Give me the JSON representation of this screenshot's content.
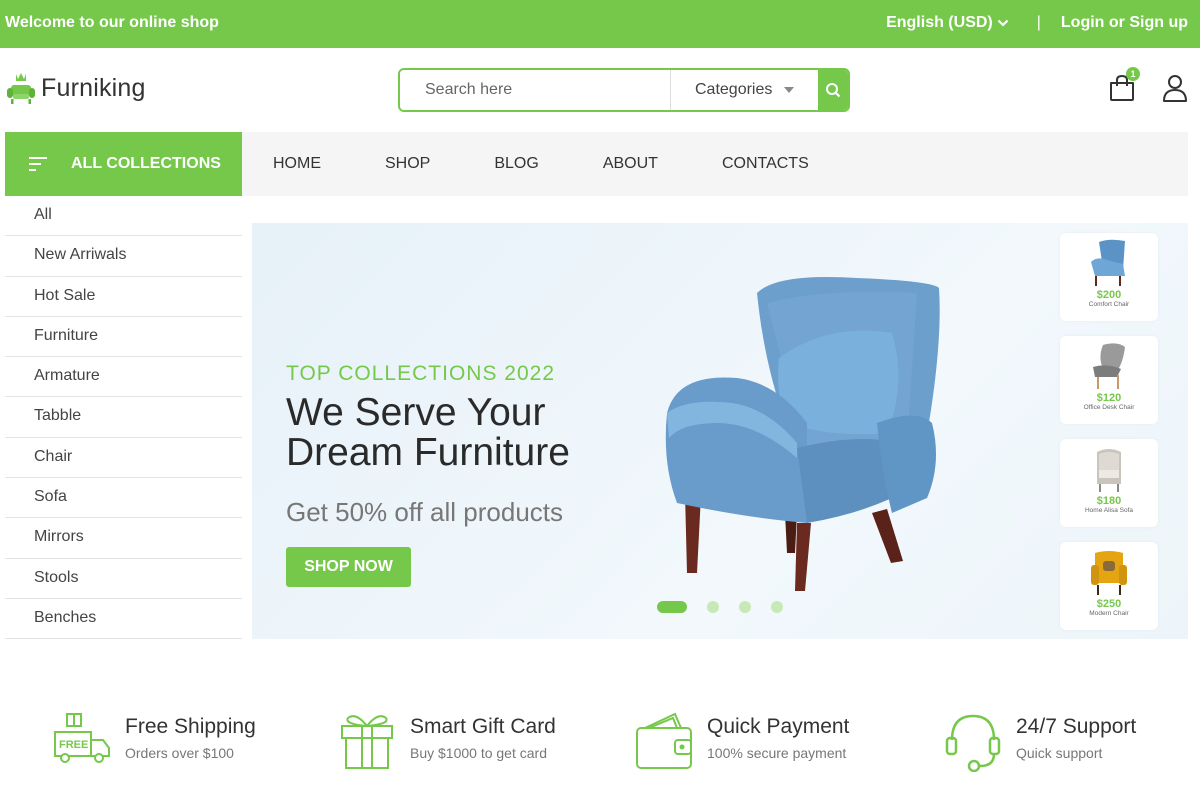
{
  "topbar": {
    "welcome": "Welcome to our online shop",
    "language": "English (USD)",
    "separator": "|",
    "login": "Login or Sign up"
  },
  "header": {
    "brand": "Furniking",
    "search_placeholder": "Search here",
    "categories_label": "Categories",
    "cart_count": "1"
  },
  "sidebar": {
    "header": "ALL COLLECTIONS",
    "items": [
      {
        "label": "All"
      },
      {
        "label": "New Arriwals"
      },
      {
        "label": "Hot Sale"
      },
      {
        "label": "Furniture"
      },
      {
        "label": "Armature"
      },
      {
        "label": "Tabble"
      },
      {
        "label": "Chair"
      },
      {
        "label": "Sofa"
      },
      {
        "label": "Mirrors"
      },
      {
        "label": "Stools"
      },
      {
        "label": "Benches"
      }
    ]
  },
  "nav": {
    "items": [
      {
        "label": "HOME"
      },
      {
        "label": "SHOP"
      },
      {
        "label": "BLOG"
      },
      {
        "label": "ABOUT"
      },
      {
        "label": "CONTACTS"
      }
    ]
  },
  "hero": {
    "eyebrow": "TOP COLLECTIONS 2022",
    "title": "We Serve Your Dream Furniture",
    "subtitle": "Get 50% off all products",
    "cta": "SHOP NOW",
    "slides_count": 4,
    "active_slide": 1,
    "thumbs": [
      {
        "price": "$200",
        "name": "Comfort Chair"
      },
      {
        "price": "$120",
        "name": "Office Desk Chair"
      },
      {
        "price": "$180",
        "name": "Home Alisa Sofa"
      },
      {
        "price": "$250",
        "name": "Modern Chair"
      }
    ]
  },
  "features": [
    {
      "title": "Free Shipping",
      "subtitle": "Orders over $100",
      "icon": "free-shipping-truck-icon"
    },
    {
      "title": "Smart Gift Card",
      "subtitle": "Buy $1000 to get card",
      "icon": "gift-icon"
    },
    {
      "title": "Quick Payment",
      "subtitle": "100% secure payment",
      "icon": "wallet-icon"
    },
    {
      "title": "24/7 Support",
      "subtitle": "Quick support",
      "icon": "headset-icon"
    }
  ],
  "colors": {
    "accent": "#76c84b",
    "nav_bg": "#f5f5f5",
    "hero_bg": "#eef5fa"
  }
}
